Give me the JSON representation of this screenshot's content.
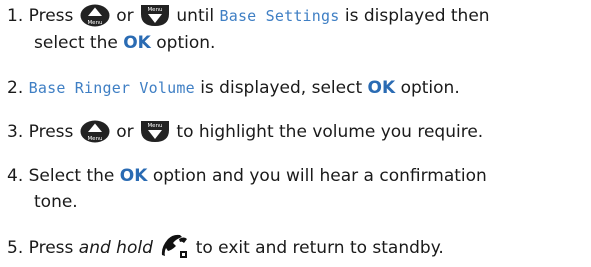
{
  "steps": [
    {
      "number": "1.",
      "press": "Press",
      "or": "or",
      "until": "until",
      "lcd_text": "Base Settings",
      "displayed_then": "is displayed then",
      "select_the": "select the",
      "ok": "OK",
      "option": "option.",
      "up_button_label": "Menu",
      "down_button_label": "Menu",
      "up_icon": "up-arrow-menu-button",
      "down_icon": "down-arrow-menu-button"
    },
    {
      "number": "2.",
      "lcd_text": "Base Ringer Volume",
      "displayed_select": "is displayed, select",
      "ok": "OK",
      "option": "option."
    },
    {
      "number": "3.",
      "press": "Press",
      "or": "or",
      "rest": "to highlight the volume you require.",
      "up_button_label": "Menu",
      "down_button_label": "Menu"
    },
    {
      "number": "4.",
      "select_the": "Select the",
      "ok": "OK",
      "rest_line1": "option and you will hear a confirmation",
      "rest_line2": "tone."
    },
    {
      "number": "5.",
      "press": "Press",
      "and_hold": "and hold",
      "rest": "to exit and return to standby.",
      "end_icon": "end-call-button"
    }
  ],
  "colors": {
    "lcd_text": "#3f7fc4",
    "ok_text": "#2a6bb3",
    "button_fill": "#222222"
  }
}
